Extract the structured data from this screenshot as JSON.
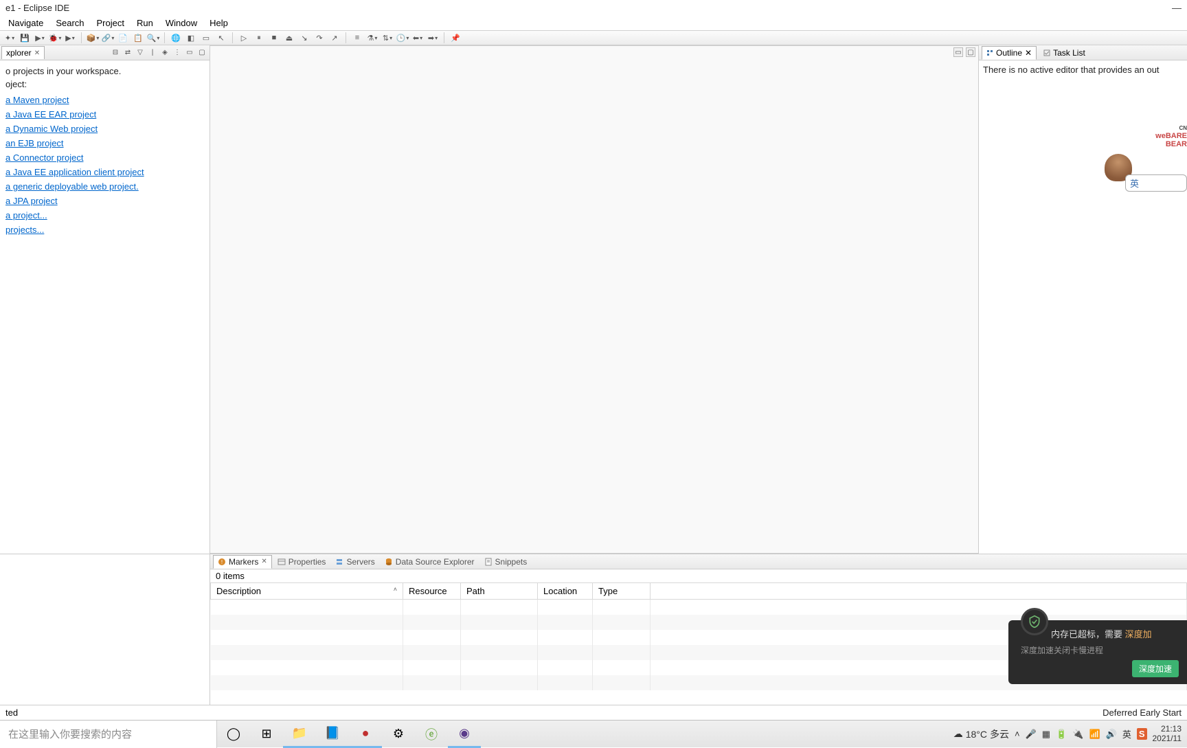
{
  "window": {
    "title": "e1 - Eclipse IDE"
  },
  "menu": {
    "items": [
      "Navigate",
      "Search",
      "Project",
      "Run",
      "Window",
      "Help"
    ]
  },
  "explorer": {
    "tab_label": "xplorer",
    "hint": "o projects in your workspace.",
    "sub_hint": "oject:",
    "links": [
      "a Maven project",
      "a Java EE EAR project",
      "a Dynamic Web project",
      "an EJB project",
      "a Connector project",
      "a Java EE application client project",
      "a generic deployable web project.",
      "a JPA project",
      "a project...",
      " projects..."
    ]
  },
  "outline": {
    "tab_outline": "Outline",
    "tab_tasklist": "Task List",
    "body_text": "There is no active editor that provides an out"
  },
  "sticker": {
    "cn": "CN",
    "line1": "weBARE",
    "line2": "BEAR",
    "bubble": "英"
  },
  "bottom_tabs": {
    "markers": "Markers",
    "properties": "Properties",
    "servers": "Servers",
    "data_source": "Data Source Explorer",
    "snippets": "Snippets"
  },
  "markers": {
    "items_count": "0 items",
    "columns": [
      "Description",
      "Resource",
      "Path",
      "Location",
      "Type"
    ]
  },
  "status": {
    "left": "ted",
    "right": "Deferred Early Start"
  },
  "notification": {
    "title_a": "内存已超标，需要 ",
    "title_b": "深度加",
    "sub": "深度加速关闭卡慢进程",
    "button": "深度加速"
  },
  "taskbar": {
    "search_placeholder": "在这里输入你要搜索的内容",
    "weather_temp": "18°C",
    "weather_desc": "多云",
    "ime": "英",
    "clock_time": "21:13",
    "clock_date": "2021/11"
  }
}
